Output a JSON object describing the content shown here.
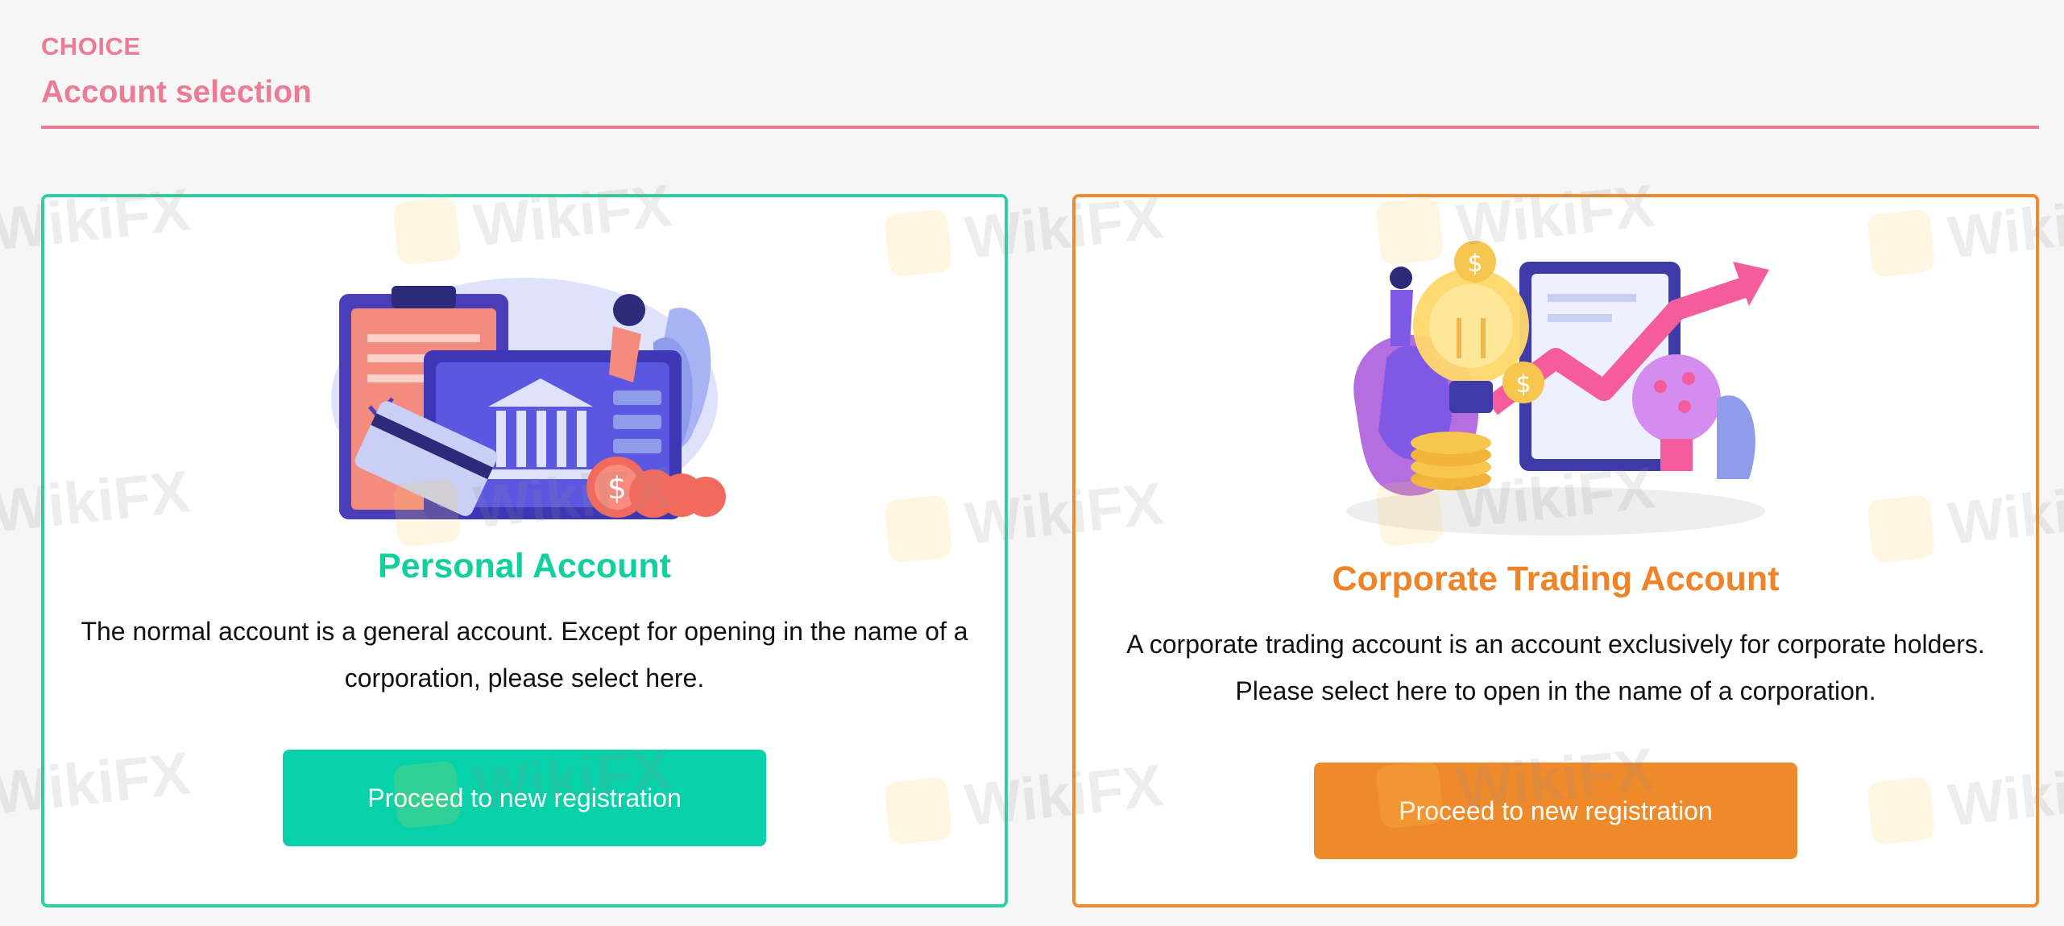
{
  "header": {
    "eyebrow": "CHOICE",
    "title": "Account selection"
  },
  "cards": [
    {
      "title": "Personal Account",
      "description": "The normal account is a general account. Except for opening in the name of a corporation, please select here.",
      "button_label": "Proceed to new registration",
      "illustration": "bank-card-illustration"
    },
    {
      "title": "Corporate Trading Account",
      "description": "A corporate trading account is an account exclusively for corporate holders. Please select here to open in the name of a corporation.",
      "button_label": "Proceed to new registration",
      "illustration": "business-growth-illustration"
    }
  ],
  "watermark": {
    "text": "WikiFX"
  },
  "colors": {
    "accent_pink": "#ec7c96",
    "personal_green": "#06d1a8",
    "corporate_orange": "#ef8a2a",
    "background": "#f6f6f6"
  }
}
